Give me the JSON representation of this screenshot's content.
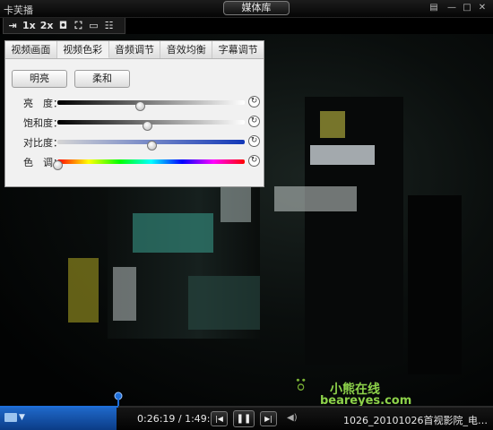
{
  "titlebar": {
    "app_title": "卡芙播",
    "library_button": "媒体库"
  },
  "quick_toolbar": {
    "speed_1x": "1x",
    "speed_2x": "2x"
  },
  "panel": {
    "tabs": [
      {
        "label": "视频画面"
      },
      {
        "label": "视频色彩"
      },
      {
        "label": "音频调节"
      },
      {
        "label": "音效均衡"
      },
      {
        "label": "字幕调节"
      }
    ],
    "active_tab": "视频色彩",
    "presets": {
      "bright": "明亮",
      "soft": "柔和"
    },
    "sliders": [
      {
        "label": "亮　度：",
        "value": 0.44
      },
      {
        "label": "饱和度：",
        "value": 0.48
      },
      {
        "label": "对比度：",
        "value": 0.5
      },
      {
        "label": "色　调：",
        "value": 0.0
      }
    ]
  },
  "video": {
    "watermark_cn": "小熊在线",
    "watermark_en": "beareyes.com"
  },
  "controls": {
    "time": "0:26:19 / 1:49:01",
    "progress": 0.24,
    "filename": "1026_20101026首视影院_电…"
  },
  "colors": {
    "accent": "#1e6fd9",
    "panel_bg": "#f1f1f1",
    "watermark": "#8dd24a"
  }
}
